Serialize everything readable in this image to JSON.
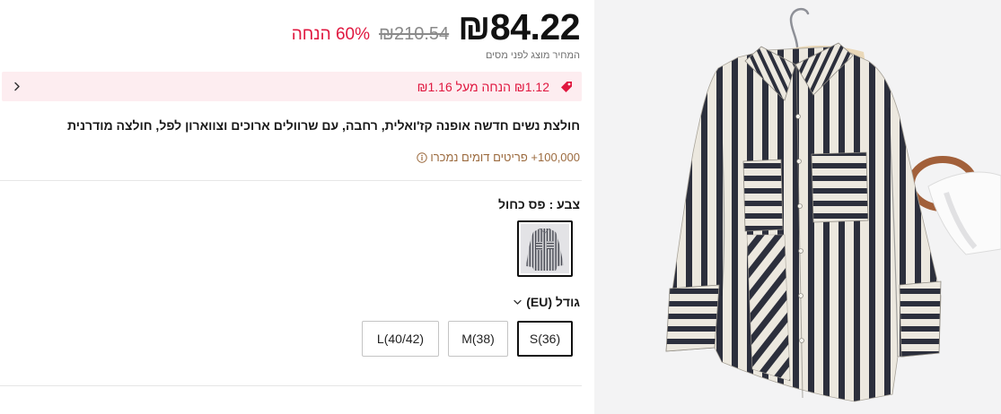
{
  "price": {
    "current": "₪84.22",
    "original": "₪210.54",
    "discount": "60% הנחה",
    "tax_note": "המחיר מוצג לפני מסים"
  },
  "coupon": {
    "text": "₪1.12 הנחה מעל ₪1.16",
    "icon": "tag-icon",
    "chevron_icon": "chevron-right-icon"
  },
  "product": {
    "title": "חולצת נשים חדשה אופנה קז'ואלית, רחבה, עם שרוולים ארוכים וצווארון לפל, חולצה מודרנית",
    "sold_text": "100,000+ פריטים דומים נמכרו",
    "info_icon": "info-icon"
  },
  "color": {
    "label": "צבע :",
    "selected": "פס כחול"
  },
  "size": {
    "label": "גודל (EU)",
    "dropdown_icon": "chevron-down-icon",
    "options": [
      {
        "label": "S(36)",
        "selected": true
      },
      {
        "label": "M(38)",
        "selected": false
      },
      {
        "label": "L(40/42)",
        "selected": false
      }
    ]
  },
  "colors": {
    "accent": "#e0173f",
    "coupon_bg": "#fdedf0",
    "sold": "#9c6b3f",
    "selected_border": "#111111",
    "strike": "#8a8a8a"
  }
}
